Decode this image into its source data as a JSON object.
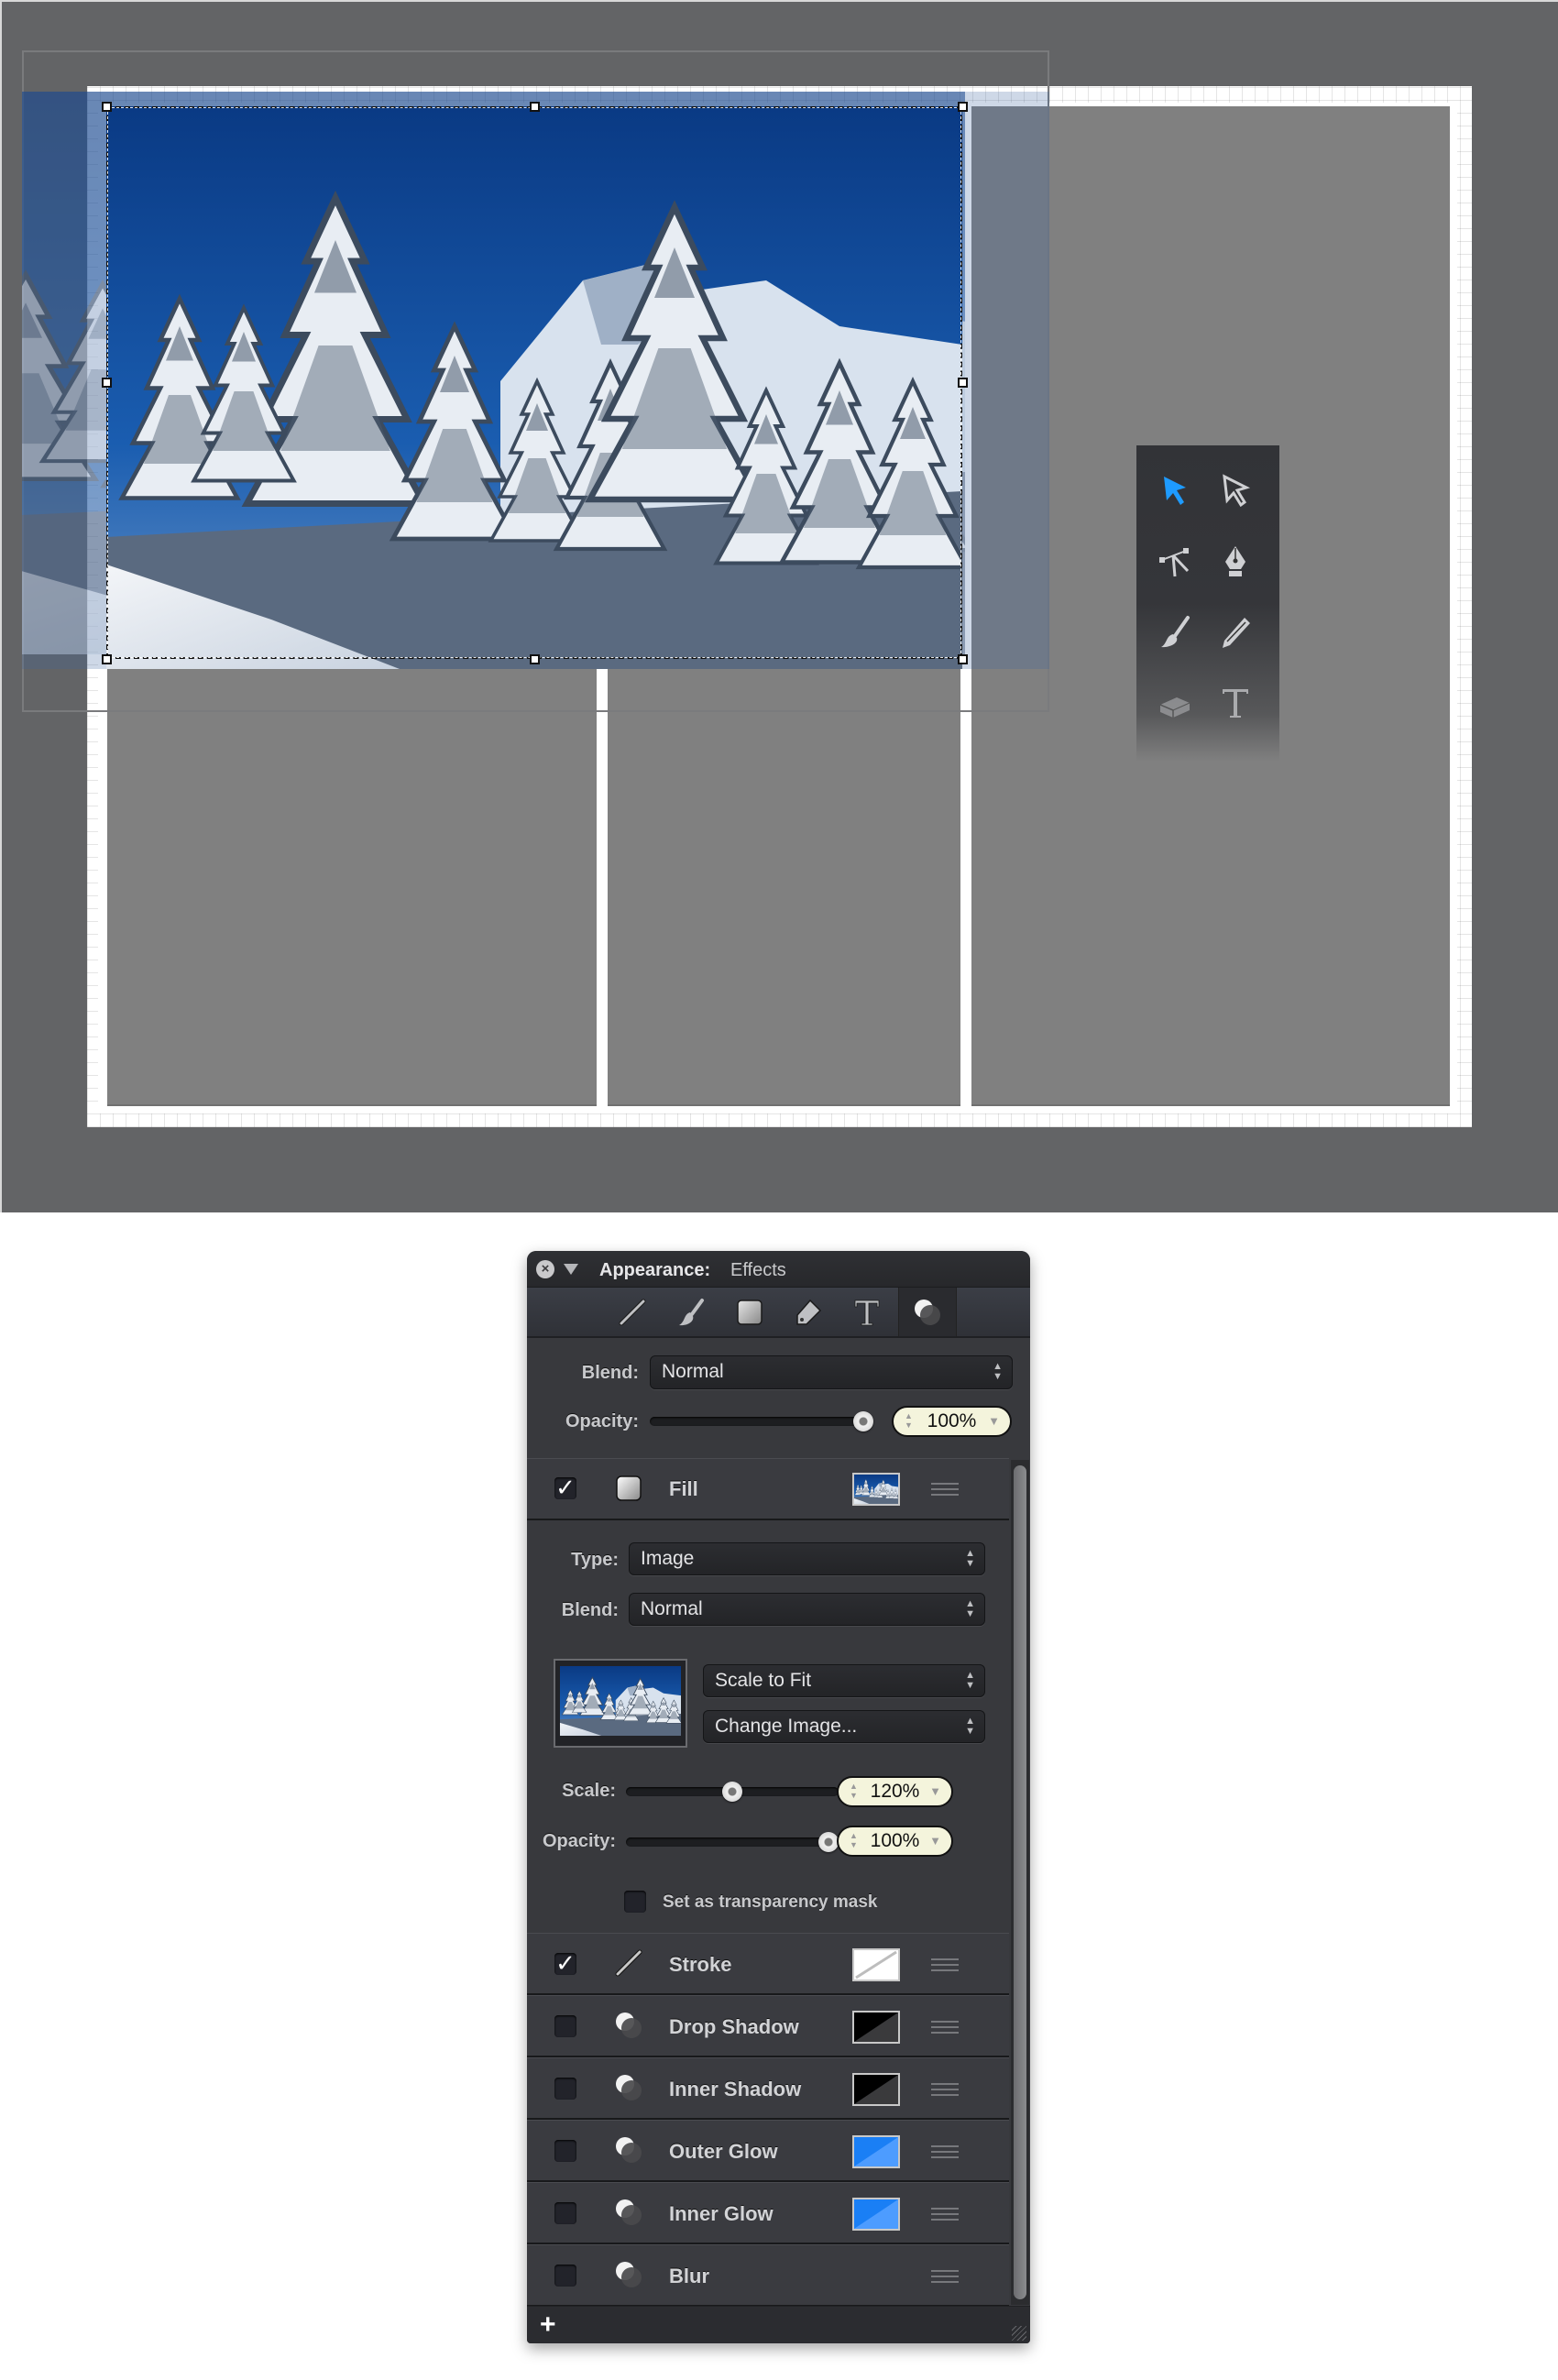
{
  "canvas": {
    "colors": {
      "workspace": "#636466",
      "page": "#ffffff",
      "placeholder_cell": "#808080",
      "selection": "#111111"
    },
    "image": {
      "subject": "snowy pine forest and mountain under blue sky"
    }
  },
  "toolbox": {
    "tools": [
      {
        "name": "selection-arrow",
        "selected": true
      },
      {
        "name": "direct-selection-arrow",
        "selected": false
      },
      {
        "name": "vector-node-tool",
        "selected": false
      },
      {
        "name": "pen-tool",
        "selected": false
      },
      {
        "name": "brush-tool",
        "selected": false
      },
      {
        "name": "pencil-tool",
        "selected": false
      },
      {
        "name": "eraser-tool",
        "selected": false
      },
      {
        "name": "text-tool",
        "selected": false
      }
    ],
    "accent": "#1e9bff"
  },
  "panel": {
    "title_bold": "Appearance:",
    "title_sub": "Effects",
    "close_glyph": "×",
    "tabs": [
      {
        "name": "stroke",
        "selected": false
      },
      {
        "name": "brush",
        "selected": false
      },
      {
        "name": "fill",
        "selected": false
      },
      {
        "name": "tag",
        "selected": false
      },
      {
        "name": "text",
        "selected": false
      },
      {
        "name": "effects",
        "selected": true
      }
    ],
    "blend": {
      "label": "Blend:",
      "value": "Normal"
    },
    "opacity": {
      "label": "Opacity:",
      "value": "100%",
      "fraction": 1.0
    },
    "fill": {
      "label": "Fill",
      "enabled": true,
      "check_glyph": "✓",
      "type": {
        "label": "Type:",
        "value": "Image"
      },
      "blend": {
        "label": "Blend:",
        "value": "Normal"
      },
      "scaling": {
        "value": "Scale to Fit"
      },
      "change_image": {
        "value": "Change Image..."
      },
      "scale": {
        "label": "Scale:",
        "value": "120%",
        "fraction": 0.5
      },
      "opacity": {
        "label": "Opacity:",
        "value": "100%",
        "fraction": 1.0
      },
      "mask": {
        "label": "Set as transparency mask",
        "checked": false
      }
    },
    "effects": [
      {
        "label": "Stroke",
        "enabled": true,
        "icon": "stroke-line",
        "swatch": "stroke-white"
      },
      {
        "label": "Drop Shadow",
        "enabled": false,
        "icon": "effects-circles",
        "swatch": "black"
      },
      {
        "label": "Inner Shadow",
        "enabled": false,
        "icon": "effects-circles",
        "swatch": "black"
      },
      {
        "label": "Outer Glow",
        "enabled": false,
        "icon": "effects-circles",
        "swatch": "blue"
      },
      {
        "label": "Inner Glow",
        "enabled": false,
        "icon": "effects-circles",
        "swatch": "blue"
      },
      {
        "label": "Blur",
        "enabled": false,
        "icon": "effects-circles",
        "swatch": null
      }
    ],
    "add_glyph": "+",
    "colors": {
      "swatch_blue": "#1a7ff5",
      "swatch_black": "#000000",
      "pill": "#f4f4dc"
    }
  }
}
